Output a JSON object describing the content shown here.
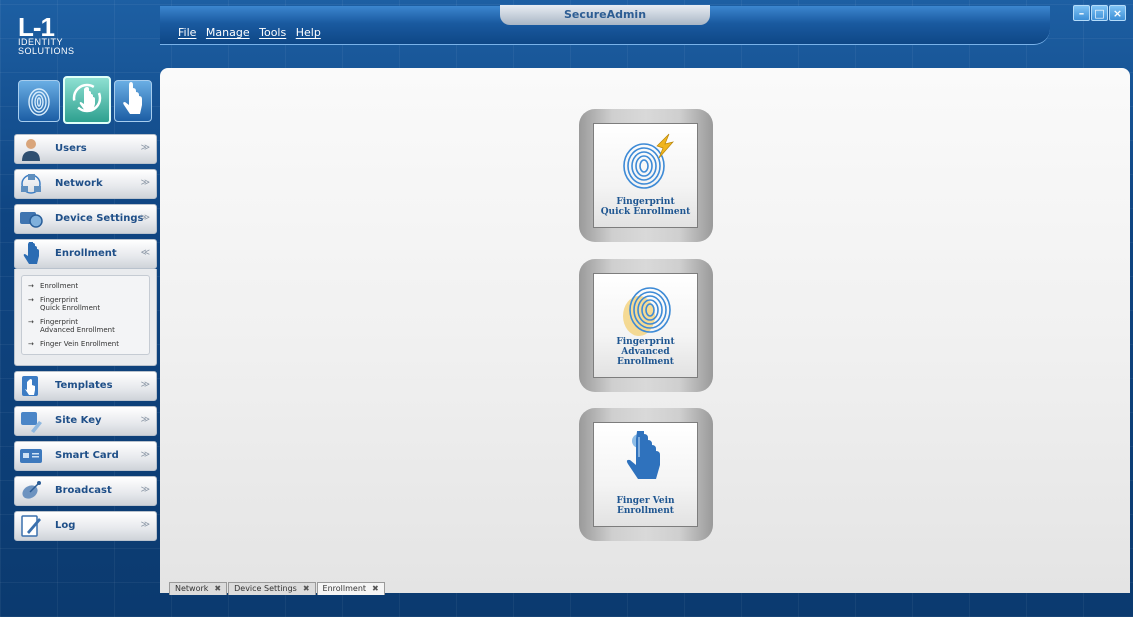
{
  "window": {
    "title": "SecureAdmin",
    "controls": {
      "minimize": "–",
      "maximize": "□",
      "close": "×"
    }
  },
  "logo": {
    "line1": "L-1",
    "line2": "IDENTITY",
    "line3": "SOLUTIONS"
  },
  "menu": [
    "File",
    "Manage",
    "Tools",
    "Help"
  ],
  "mode_buttons": [
    {
      "name": "fingerprint-mode",
      "icon": "fingerprint-icon",
      "active": false
    },
    {
      "name": "enrollment-mode",
      "icon": "hand-touch-icon",
      "active": true
    },
    {
      "name": "vein-mode",
      "icon": "finger-vein-icon",
      "active": false
    }
  ],
  "sidebar": {
    "items": [
      {
        "label": "Users",
        "icon": "user-icon",
        "chevron": "≫"
      },
      {
        "label": "Network",
        "icon": "network-icon",
        "chevron": "≫"
      },
      {
        "label": "Device Settings",
        "icon": "device-settings-icon",
        "chevron": "≫"
      },
      {
        "label": "Enrollment",
        "icon": "enrollment-icon",
        "chevron": "≪"
      },
      {
        "label": "Templates",
        "icon": "templates-icon",
        "chevron": "≫"
      },
      {
        "label": "Site Key",
        "icon": "site-key-icon",
        "chevron": "≫"
      },
      {
        "label": "Smart Card",
        "icon": "smart-card-icon",
        "chevron": "≫"
      },
      {
        "label": "Broadcast",
        "icon": "broadcast-icon",
        "chevron": "≫"
      },
      {
        "label": "Log",
        "icon": "log-icon",
        "chevron": "≫"
      }
    ],
    "enrollment_sub": [
      {
        "line1": "Enrollment",
        "line2": ""
      },
      {
        "line1": "Fingerprint",
        "line2": "Quick Enrollment"
      },
      {
        "line1": "Fingerprint",
        "line2": "Advanced Enrollment"
      },
      {
        "line1": "Finger Vein Enrollment",
        "line2": ""
      }
    ]
  },
  "tiles": [
    {
      "line1": "Fingerprint",
      "line2": "Quick Enrollment",
      "icon": "fingerprint-quick-icon"
    },
    {
      "line1": "Fingerprint",
      "line2": "Advanced Enrollment",
      "icon": "fingerprint-advanced-icon"
    },
    {
      "line1": "Finger Vein",
      "line2": "Enrollment",
      "icon": "finger-vein-icon"
    }
  ],
  "doc_tabs": [
    {
      "label": "Network",
      "close": "✖",
      "active": false
    },
    {
      "label": "Device Settings",
      "close": "✖",
      "active": false
    },
    {
      "label": "Enrollment",
      "close": "✖",
      "active": true
    }
  ],
  "colors": {
    "accent": "#1f5691",
    "frame": "#0f4582",
    "active_mode": "#2ea08f"
  }
}
